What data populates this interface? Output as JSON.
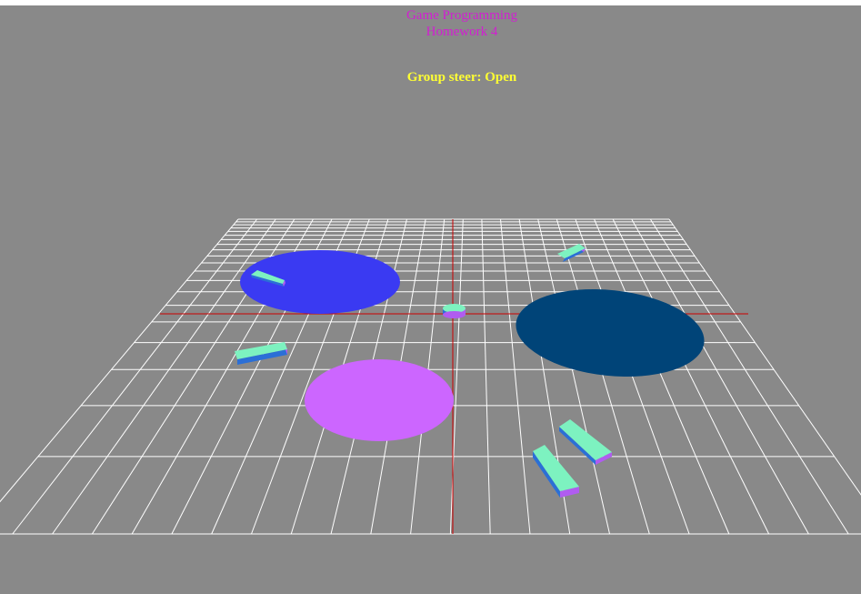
{
  "title": {
    "line1": "Game Programming",
    "line2": "Homework 4",
    "color": "#d21ed2"
  },
  "status": {
    "text": "Group steer: Open",
    "color": "#ffff33"
  },
  "scene": {
    "background": "#898989",
    "grid_color": "#ffffff",
    "axis_color": "#cc0000",
    "obstacles": [
      {
        "name": "obstacle-blue",
        "color": "#3a3af2"
      },
      {
        "name": "obstacle-navy",
        "color": "#004478"
      },
      {
        "name": "obstacle-violet",
        "color": "#cc66ff"
      }
    ],
    "agent_colors": {
      "top": "#7df2c0",
      "side": "#2b6fd6",
      "end": "#b05cf0"
    }
  }
}
